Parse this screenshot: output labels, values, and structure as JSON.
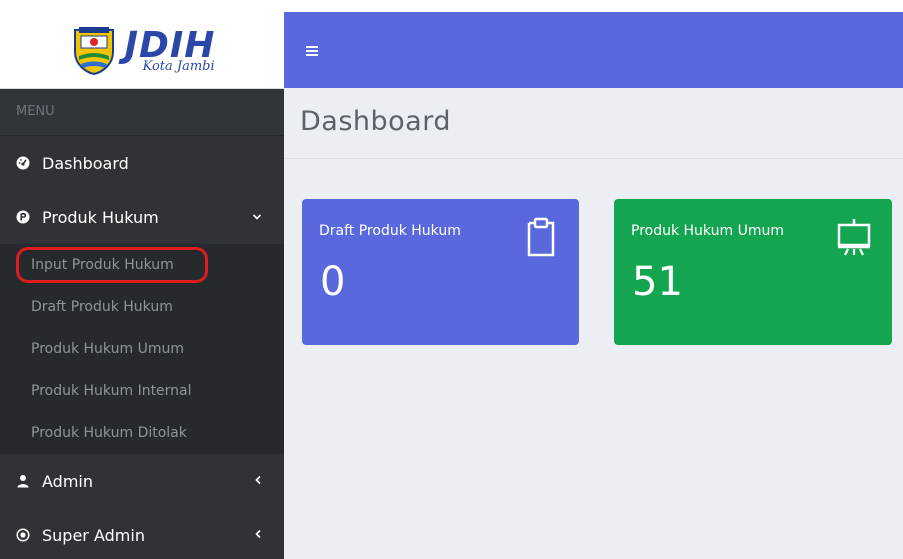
{
  "brand": {
    "name": "JDIH",
    "subtitle": "Kota Jambi"
  },
  "sidebar": {
    "menu_header": "MENU",
    "items": [
      {
        "label": "Dashboard",
        "icon": "tachometer-icon"
      },
      {
        "label": "Produk Hukum",
        "icon": "p-circle-icon",
        "expanded": true,
        "children": [
          "Input Produk Hukum",
          "Draft Produk Hukum",
          "Produk Hukum Umum",
          "Produk Hukum Internal",
          "Produk Hukum Ditolak"
        ]
      },
      {
        "label": "Admin",
        "icon": "user-icon"
      },
      {
        "label": "Super Admin",
        "icon": "target-icon"
      }
    ]
  },
  "header": {
    "page_title": "Dashboard"
  },
  "cards": [
    {
      "label": "Draft Produk Hukum",
      "value": "0",
      "icon": "clipboard-icon",
      "color": "#5a68de"
    },
    {
      "label": "Produk Hukum Umum",
      "value": "51",
      "icon": "presentation-board-icon",
      "color": "#14a551"
    }
  ],
  "colors": {
    "navbar": "#5a68de",
    "sidebar": "#2f3338",
    "highlight": "#e01d1d"
  }
}
